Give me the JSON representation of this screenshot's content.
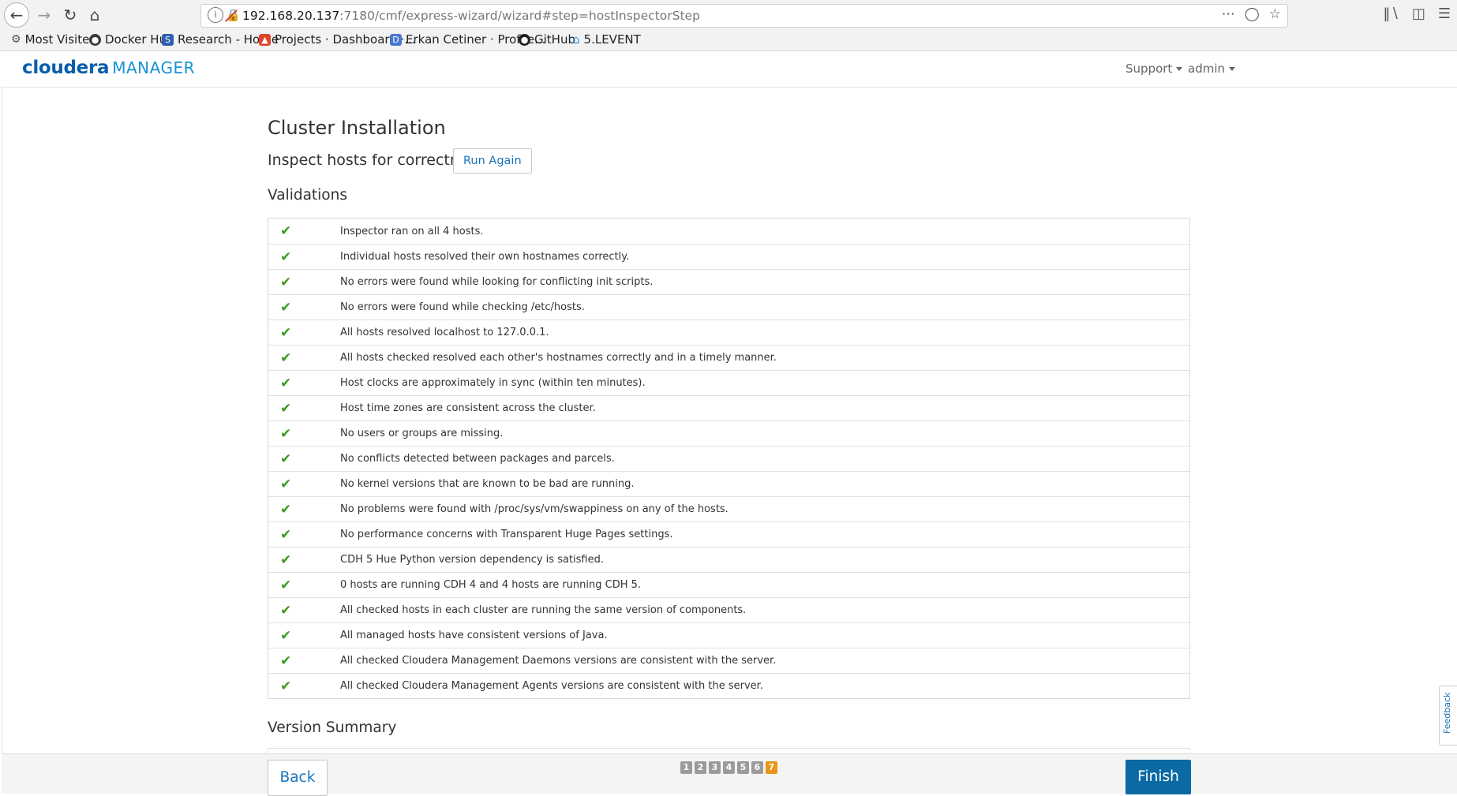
{
  "browser": {
    "url_host": "192.168.20.137",
    "url_rest": ":7180/cmf/express-wizard/wizard#step=hostInspectorStep",
    "bookmarks": [
      {
        "label": "Most Visited",
        "icon": "gear-icon"
      },
      {
        "label": "Docker Hub",
        "icon": "docker-icon"
      },
      {
        "label": "Research - Home",
        "icon": "research-icon"
      },
      {
        "label": "Projects · Dashboard ·...",
        "icon": "gitlab-icon"
      },
      {
        "label": "Erkan Cetiner · Profile...",
        "icon": "profile-icon"
      },
      {
        "label": "GitHub",
        "icon": "github-icon"
      },
      {
        "label": "5.LEVENT",
        "icon": "home-icon"
      }
    ]
  },
  "header": {
    "logo_main": "cloudera",
    "logo_sub": "MANAGER",
    "support": "Support",
    "user": "admin"
  },
  "main": {
    "title": "Cluster Installation",
    "subtitle": "Inspect hosts for correctness",
    "run_again": "Run Again",
    "validations_title": "Validations",
    "validations": [
      "Inspector ran on all 4 hosts.",
      "Individual hosts resolved their own hostnames correctly.",
      "No errors were found while looking for conflicting init scripts.",
      "No errors were found while checking /etc/hosts.",
      "All hosts resolved localhost to 127.0.0.1.",
      "All hosts checked resolved each other's hostnames correctly and in a timely manner.",
      "Host clocks are approximately in sync (within ten minutes).",
      "Host time zones are consistent across the cluster.",
      "No users or groups are missing.",
      "No conflicts detected between packages and parcels.",
      "No kernel versions that are known to be bad are running.",
      "No problems were found with /proc/sys/vm/swappiness on any of the hosts.",
      "No performance concerns with Transparent Huge Pages settings.",
      "CDH 5 Hue Python version dependency is satisfied.",
      "0 hosts are running CDH 4 and 4 hosts are running CDH 5.",
      "All checked hosts in each cluster are running the same version of components.",
      "All managed hosts have consistent versions of Java.",
      "All checked Cloudera Management Daemons versions are consistent with the server.",
      "All checked Cloudera Management Agents versions are consistent with the server."
    ],
    "version_summary_title": "Version Summary"
  },
  "footer": {
    "back": "Back",
    "finish": "Finish",
    "steps": [
      "1",
      "2",
      "3",
      "4",
      "5",
      "6",
      "7"
    ],
    "active_step": "7"
  },
  "feedback": "Feedback",
  "colors": {
    "accent": "#0b6aa3",
    "link": "#1a73b8",
    "check": "#3a9b1f",
    "active_step": "#e8951a"
  }
}
